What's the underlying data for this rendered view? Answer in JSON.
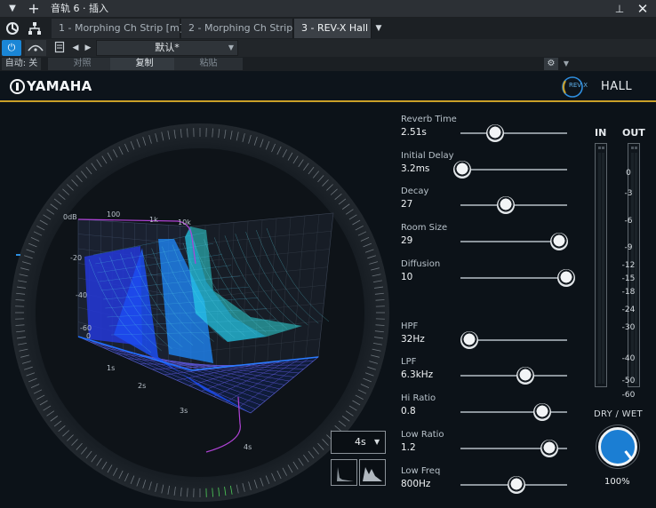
{
  "window": {
    "title": "音轨 6 · 插入",
    "menu_arrow": "▼",
    "add_glyph": "+",
    "pin_glyph": "⊥",
    "close_glyph": "✕"
  },
  "tabs": [
    {
      "label": "1 - Morphing Ch Strip [m]",
      "active": false
    },
    {
      "label": "2 - Morphing Ch Strip",
      "active": false
    },
    {
      "label": "3 - REV-X Hall",
      "active": true
    }
  ],
  "toolbar": {
    "preset_name": "默认*",
    "auto_label": "自动: 关",
    "compare_label": "对照",
    "copy_label": "复制",
    "paste_label": "粘贴"
  },
  "plugin": {
    "brand": "YAMAHA",
    "revx_logo_text": "REV X",
    "mode": "HALL",
    "time_range": "4s",
    "accent_color": "#caa028",
    "graph_labels": {
      "db": [
        "0dB",
        "-20",
        "-40",
        "-60"
      ],
      "freq": [
        "100",
        "1k",
        "10k"
      ],
      "time": [
        "0",
        "1s",
        "2s",
        "3s",
        "4s"
      ]
    }
  },
  "params": [
    {
      "name": "Reverb Time",
      "value": "2.51s",
      "position": 0.32
    },
    {
      "name": "Initial Delay",
      "value": "3.2ms",
      "position": 0.0
    },
    {
      "name": "Decay",
      "value": "27",
      "position": 0.42
    },
    {
      "name": "Room Size",
      "value": "29",
      "position": 0.93
    },
    {
      "name": "Diffusion",
      "value": "10",
      "position": 1.0
    },
    {
      "name": "HPF",
      "value": "32Hz",
      "position": 0.07
    },
    {
      "name": "LPF",
      "value": "6.3kHz",
      "position": 0.61
    },
    {
      "name": "Hi Ratio",
      "value": "0.8",
      "position": 0.77
    },
    {
      "name": "Low Ratio",
      "value": "1.2",
      "position": 0.84
    },
    {
      "name": "Low Freq",
      "value": "800Hz",
      "position": 0.52
    }
  ],
  "meters": {
    "in_label": "IN",
    "out_label": "OUT",
    "scale": [
      "0",
      "-3",
      "-6",
      "-9",
      "-12",
      "-15",
      "-18",
      "-24",
      "-30",
      "-40",
      "-50",
      "-60"
    ]
  },
  "dry_wet": {
    "label": "DRY / WET",
    "value": "100%",
    "knob_color": "#1b7ed3"
  }
}
